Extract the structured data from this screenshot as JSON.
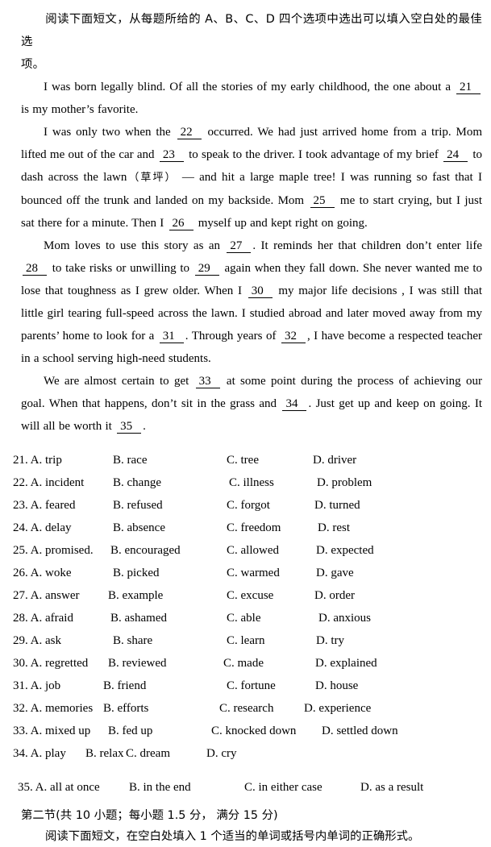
{
  "document": {
    "section1_instruction": {
      "line1": "阅读下面短文，从每题所给的  A、B、C、D  四个选项中选出可以填入空白处的最佳选",
      "line2": "项。"
    },
    "passage": {
      "paragraph1": {
        "t1": "I was born legally blind. Of all the stories of my early childhood, the one about a",
        "b1": "21",
        "t2": "is my mother’s favorite."
      },
      "paragraph2": {
        "t1": "I was only two when the",
        "b1": "22",
        "t2": "occurred. We had just arrived home from a trip. Mom lifted me out of the car and",
        "b2": "23",
        "t3": "to speak to the driver. I took advantage of my brief",
        "b3": "24",
        "t4": "to dash across the lawn",
        "cn": "（草坪）",
        "t5": "— and hit a large maple tree! I was running so fast that I bounced off the trunk and landed on my backside. Mom",
        "b4": "25",
        "t6": "me to start crying, but I just sat there for a minute. Then I",
        "b5": "26",
        "t7": "myself up and kept right on going."
      },
      "paragraph3": {
        "t1": "Mom loves to use this story as an",
        "b1": "27",
        "t2": ". It reminds her that children don’t enter life",
        "b2": "28",
        "t3": "to take risks or unwilling to",
        "b3": "29",
        "t4": "again when they fall down. She never wanted me to lose that toughness as I grew older. When I",
        "b4": "30",
        "t5": "my major life decisions , I was still that little girl tearing full-speed across the lawn. I studied abroad and later moved away from my parents’ home to look for a",
        "b5": "31",
        "t6": ". Through years of",
        "b6": "32",
        "t7": ", I have become a respected teacher in a school serving high-need students."
      },
      "paragraph4": {
        "t1": "We are almost certain to get",
        "b1": "33",
        "t2": "at some point during the process of achieving our goal. When that happens, don’t sit in the grass and",
        "b2": "34",
        "t3": ". Just get up and keep on going. It will all be worth it",
        "b3": "35",
        "t4": "."
      }
    },
    "questions": [
      {
        "number": "21. A. trip",
        "b": "B. race",
        "c": "C. tree",
        "d": "D. driver"
      },
      {
        "number": "22. A. incident",
        "b": "B. change",
        "c": "C. illness",
        "d": "D. problem"
      },
      {
        "number": "23. A. feared",
        "b": "B. refused",
        "c": "C. forgot",
        "d": "D. turned"
      },
      {
        "number": "24. A. delay",
        "b": "B. absence",
        "c": "C. freedom",
        "d": "D. rest"
      },
      {
        "number": "25. A. promised.",
        "b": "B. encouraged",
        "c": "C. allowed",
        "d": "D. expected"
      },
      {
        "number": "26. A. woke",
        "b": "B. picked",
        "c": "C. warmed",
        "d": "D. gave"
      },
      {
        "number": "27. A. answer",
        "b": "B. example",
        "c": "C. excuse",
        "d": "D. order"
      },
      {
        "number": "28. A. afraid",
        "b": "B. ashamed",
        "c": "C. able",
        "d": "D. anxious"
      },
      {
        "number": "29. A. ask",
        "b": "B. share",
        "c": "C. learn",
        "d": "D. try"
      },
      {
        "number": "30. A. regretted",
        "b": "B. reviewed",
        "c": "C. made",
        "d": "D. explained"
      },
      {
        "number": "31. A. job",
        "b": "B. friend",
        "c": "C. fortune",
        "d": "D. house"
      },
      {
        "number": "32. A. memories",
        "b": "B. efforts",
        "c": "C. research",
        "d": "D. experience"
      },
      {
        "number": "33. A. mixed up",
        "b": "B. fed up",
        "c": "C. knocked down",
        "d": "D. settled down"
      },
      {
        "number": "34. A. play",
        "b": "B. relax",
        "c": "C. dream",
        "d": "D. cry"
      },
      {
        "number": "35. A. all at once",
        "b": "B. in the end",
        "c": "C. in either case",
        "d": "D. as a result"
      }
    ],
    "section2": {
      "title": "第二节(共 10 小题；每小题 1.5 分， 满分 15 分)",
      "instruction": "阅读下面短文，在空白处填入 1 个适当的单词或括号内单词的正确形式。"
    }
  }
}
